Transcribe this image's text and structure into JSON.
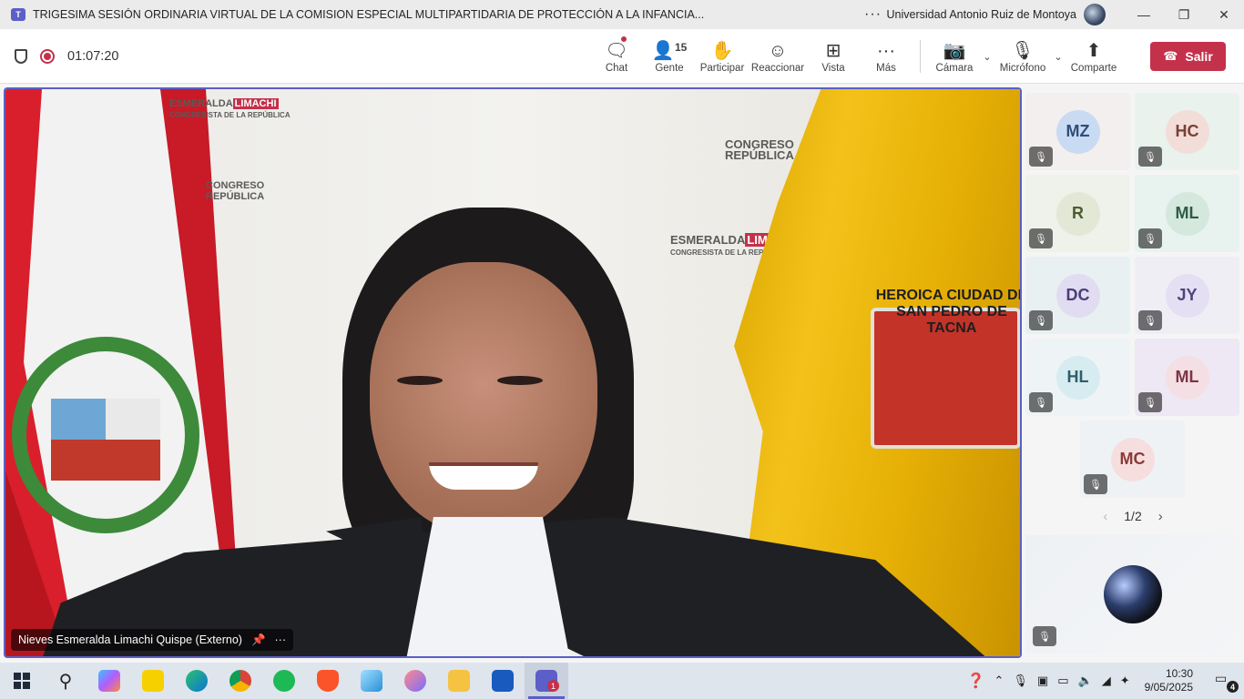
{
  "window": {
    "title": "TRIGESIMA SESIÓN ORDINARIA VIRTUAL DE LA COMISION ESPECIAL MULTIPARTIDARIA DE PROTECCIÓN A LA INFANCIA...",
    "more": "···",
    "org_name": "Universidad Antonio Ruiz de Montoya",
    "minimize": "—",
    "maximize": "❐",
    "close": "✕"
  },
  "toolbar": {
    "timer": "01:07:20",
    "chat": "Chat",
    "people": "Gente",
    "people_count": "15",
    "raise": "Participar",
    "react": "Reaccionar",
    "view": "Vista",
    "more": "Más",
    "camera": "Cámara",
    "mic": "Micrófono",
    "share": "Comparte",
    "leave": "Salir"
  },
  "stage": {
    "speaker_name": "Nieves Esmeralda Limachi Quispe (Externo)",
    "banners": [
      {
        "top": "ESMERALDA",
        "accent": "LIMACHI",
        "sub": "CONGRESISTA DE LA REPÚBLICA"
      },
      {
        "top": "CONGRESO",
        "sub": "REPÚBLICA"
      },
      {
        "top": "CONGRESO",
        "sub": "REPÚBLICA"
      },
      {
        "top": "ESMERALDA",
        "accent": "LIMACHI",
        "sub": "CONGRESISTA DE LA REPÚBLICA"
      }
    ],
    "crest_text": "HEROICA CIUDAD DE SAN PEDRO DE TACNA"
  },
  "participants": [
    {
      "initials": "MZ",
      "bg": "#f3efee",
      "avbg": "#c9dbf2",
      "fg": "#2f4d7a"
    },
    {
      "initials": "HC",
      "bg": "#eaf2ee",
      "avbg": "#f2ddd8",
      "fg": "#7a3f34"
    },
    {
      "initials": "R",
      "bg": "#eef2ea",
      "avbg": "#e3e8d6",
      "fg": "#4d5a2f"
    },
    {
      "initials": "ML",
      "bg": "#e8f2ee",
      "avbg": "#d4e8de",
      "fg": "#2f5a46"
    },
    {
      "initials": "DC",
      "bg": "#e8f0f2",
      "avbg": "#e2dcf2",
      "fg": "#4a3f7a"
    },
    {
      "initials": "JY",
      "bg": "#f0eef5",
      "avbg": "#e4dff2",
      "fg": "#4e467a"
    },
    {
      "initials": "HL",
      "bg": "#eef3f6",
      "avbg": "#d6ecf0",
      "fg": "#2f5e6a"
    },
    {
      "initials": "ML",
      "bg": "#ede8f4",
      "avbg": "#f4dfe4",
      "fg": "#7a3446"
    },
    {
      "initials": "MC",
      "bg": "#eef2f5",
      "avbg": "#f6dede",
      "fg": "#8a3a3a"
    }
  ],
  "pager": {
    "label": "1/2",
    "prev": "‹",
    "next": "›"
  },
  "taskbar": {
    "time": "10:30",
    "date": "9/05/2025",
    "notifications": "4",
    "teams_badge": "1"
  },
  "colors": {
    "accent": "#5b5fc7",
    "leave": "#c4314b"
  }
}
